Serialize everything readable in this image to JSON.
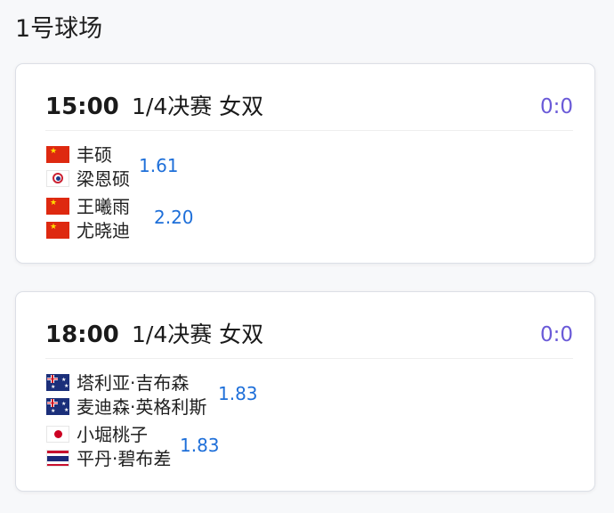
{
  "court": {
    "title": "1号球场"
  },
  "matches": [
    {
      "time": "15:00",
      "round": "1/4决赛 女双",
      "score": "0:0",
      "pairs": [
        {
          "odds": "1.61",
          "players": [
            {
              "name": "丰硕",
              "flag": "china-flag-icon"
            },
            {
              "name": "梁恩硕",
              "flag": "chinese-taipei-flag-icon"
            }
          ]
        },
        {
          "odds": "2.20",
          "players": [
            {
              "name": "王曦雨",
              "flag": "china-flag-icon"
            },
            {
              "name": "尤晓迪",
              "flag": "china-flag-icon"
            }
          ]
        }
      ]
    },
    {
      "time": "18:00",
      "round": "1/4决赛 女双",
      "score": "0:0",
      "pairs": [
        {
          "odds": "1.83",
          "players": [
            {
              "name": "塔利亚·吉布森",
              "flag": "australia-flag-icon"
            },
            {
              "name": "麦迪森·英格利斯",
              "flag": "australia-flag-icon"
            }
          ]
        },
        {
          "odds": "1.83",
          "players": [
            {
              "name": "小堀桃子",
              "flag": "japan-flag-icon"
            },
            {
              "name": "平丹·碧布差",
              "flag": "thailand-flag-icon"
            }
          ]
        }
      ]
    }
  ],
  "colors": {
    "score": "#6a5ad8",
    "odds": "#1e6fd9",
    "card_border": "#dcdfe6"
  }
}
